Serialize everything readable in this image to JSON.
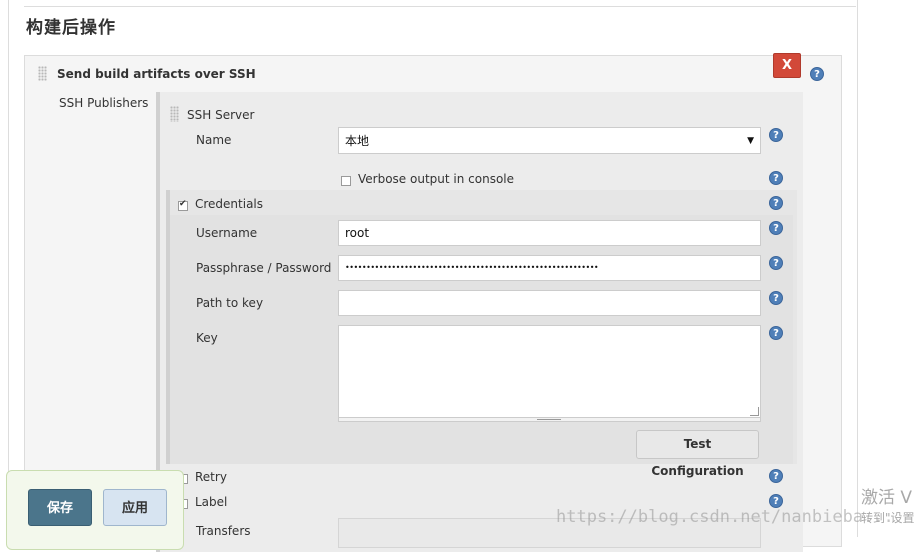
{
  "section": {
    "title": "构建后操作"
  },
  "builder": {
    "title": "Send build artifacts over SSH",
    "delete_label": "X",
    "publishers_label": "SSH Publishers"
  },
  "ssh_server": {
    "label": "SSH Server",
    "name_label": "Name",
    "name_value": "本地",
    "verbose_label": "Verbose output in console",
    "verbose_checked": false
  },
  "credentials": {
    "label": "Credentials",
    "checked": true,
    "username_label": "Username",
    "username_value": "root",
    "password_label": "Passphrase / Password",
    "password_value": "••••••••••••••••••••••••••••••••••••••••••••••••••••••••••••",
    "path_label": "Path to key",
    "path_value": "",
    "key_label": "Key",
    "key_value": "",
    "test_button": "Test Configuration"
  },
  "advanced": {
    "retry_label": "Retry",
    "label_label": "Label",
    "transfers_label": "Transfers"
  },
  "footer": {
    "save_label": "保存",
    "apply_label": "应用"
  },
  "overlay": {
    "watermark_url": "https://blog.csdn.net/nanbieba...",
    "activate_text": "激活 V",
    "activate_sub": "转到\"设置"
  },
  "help_icon_glyph": "?",
  "dropdown_glyph": "▼",
  "colors": {
    "delete_button": "#d24939",
    "save_button": "#4b758b",
    "apply_button": "#d7e4f1",
    "help_icon": "#4f7fb8"
  }
}
